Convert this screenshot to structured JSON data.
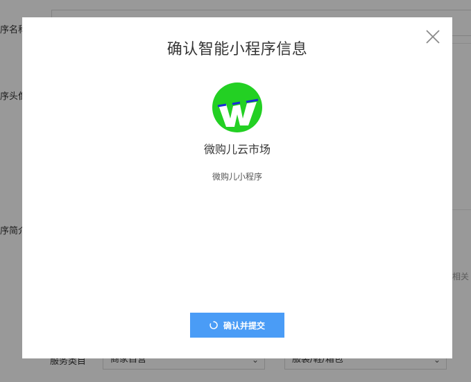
{
  "background_form": {
    "labels": [
      "序名称",
      "序头像",
      "序简介",
      "服务类目"
    ],
    "side_hint": "相关",
    "category_primary": "商家自营",
    "category_secondary": "服装/鞋/箱包"
  },
  "modal": {
    "title": "确认智能小程序信息",
    "app_name": "微购儿云市场",
    "app_description": "微购儿小程序",
    "confirm_label": "确认并提交"
  },
  "colors": {
    "primary_button": "#4a9cf6",
    "logo_green": "#23d023",
    "logo_blue": "#1a2bd6",
    "overlay": "rgba(0,0,0,0.40)"
  },
  "icons": {
    "close": "close-icon",
    "spinner": "loading-spinner-icon",
    "logo": "app-logo-w"
  }
}
